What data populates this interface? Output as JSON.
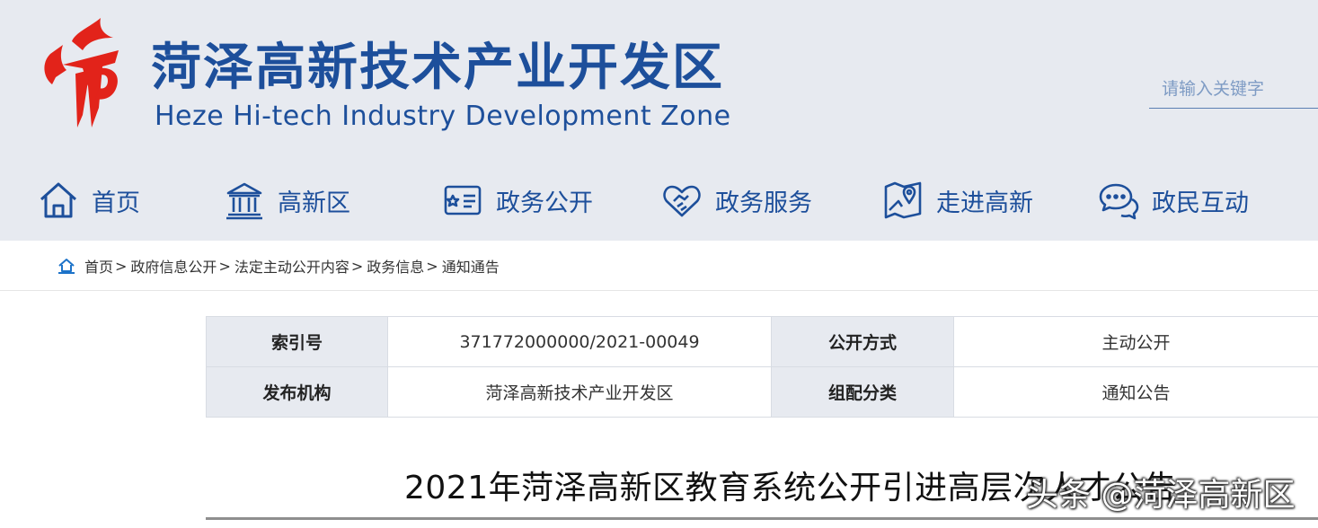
{
  "header": {
    "title_cn": "菏泽高新技术产业开发区",
    "title_en": "Heze Hi-tech Industry Development Zone",
    "search_placeholder": "请输入关键字"
  },
  "nav": [
    {
      "label": "首页",
      "icon": "home-icon"
    },
    {
      "label": "高新区",
      "icon": "building-icon"
    },
    {
      "label": "政务公开",
      "icon": "id-card-icon"
    },
    {
      "label": "政务服务",
      "icon": "handshake-icon"
    },
    {
      "label": "走进高新",
      "icon": "map-icon"
    },
    {
      "label": "政民互动",
      "icon": "chat-icon"
    }
  ],
  "breadcrumb": [
    "首页",
    "政府信息公开",
    "法定主动公开内容",
    "政务信息",
    "通知通告"
  ],
  "breadcrumb_sep": ">",
  "meta": {
    "index_label": "索引号",
    "index_value": "371772000000/2021-00049",
    "mode_label": "公开方式",
    "mode_value": "主动公开",
    "publisher_label": "发布机构",
    "publisher_value": "菏泽高新技术产业开发区",
    "category_label": "组配分类",
    "category_value": "通知公告"
  },
  "article": {
    "title": "2021年菏泽高新区教育系统公开引进高层次人才公告"
  },
  "watermark": "头条 @菏泽高新区",
  "colors": {
    "brand_blue": "#1d4f9b",
    "logo_red": "#e2231a",
    "header_bg": "#e7eaf0"
  }
}
